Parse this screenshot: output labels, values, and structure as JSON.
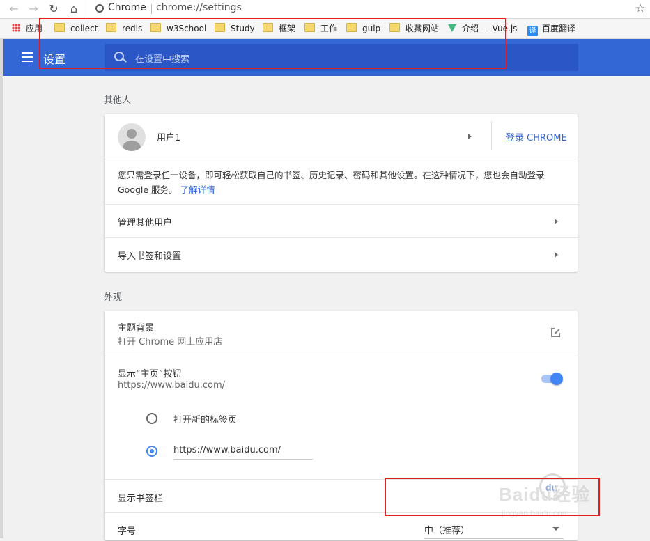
{
  "toolbar": {
    "back_icon": "back-arrow-icon",
    "forward_icon": "forward-arrow-icon",
    "reload_icon": "reload-icon",
    "home_icon": "home-icon"
  },
  "address": {
    "site_label": "Chrome",
    "url": "chrome://settings"
  },
  "bookmarks": [
    {
      "label": "应用",
      "icon": "apps-grid-icon"
    },
    {
      "label": "collect",
      "icon": "folder-icon"
    },
    {
      "label": "redis",
      "icon": "folder-icon"
    },
    {
      "label": "w3School",
      "icon": "folder-icon"
    },
    {
      "label": "Study",
      "icon": "folder-icon"
    },
    {
      "label": "框架",
      "icon": "folder-icon"
    },
    {
      "label": "工作",
      "icon": "folder-icon"
    },
    {
      "label": "gulp",
      "icon": "folder-icon"
    },
    {
      "label": "收藏网站",
      "icon": "folder-icon"
    },
    {
      "label": "介绍 — Vue.js",
      "icon": "vue-logo-icon"
    },
    {
      "label": "百度翻译",
      "icon": "translate-icon",
      "icon_text": "译"
    }
  ],
  "header": {
    "title": "设置",
    "search_placeholder": "在设置中搜索"
  },
  "people": {
    "section_title": "其他人",
    "user_name": "用户1",
    "sign_in_button": "登录 CHROME",
    "description": "您只需登录任一设备，即可轻松获取自己的书签、历史记录、密码和其他设置。在这种情况下，您也会自动登录 Google 服务。",
    "learn_more": "了解详情",
    "manage_other_users": "管理其他用户",
    "import_bookmarks": "导入书签和设置"
  },
  "appearance": {
    "section_title": "外观",
    "theme_title": "主题背景",
    "theme_subtitle": "打开 Chrome 网上应用店",
    "home_button_title": "显示“主页”按钮",
    "home_button_subtitle": "https://www.baidu.com/",
    "home_button_enabled": true,
    "radio_new_tab": "打开新的标签页",
    "radio_custom_url": "https://www.baidu.com/",
    "selected_radio": "custom_url",
    "bookmarks_bar_title": "显示书签栏",
    "font_size_title": "字号",
    "font_size_value": "中（推荐）"
  },
  "watermark": {
    "text": "Baidu经验",
    "sub_text": "jingyan.baidu.com"
  },
  "colors": {
    "header": "#3367d6",
    "search_bg": "#2a56c6",
    "accent": "#4285f4",
    "link": "#3367d6"
  }
}
